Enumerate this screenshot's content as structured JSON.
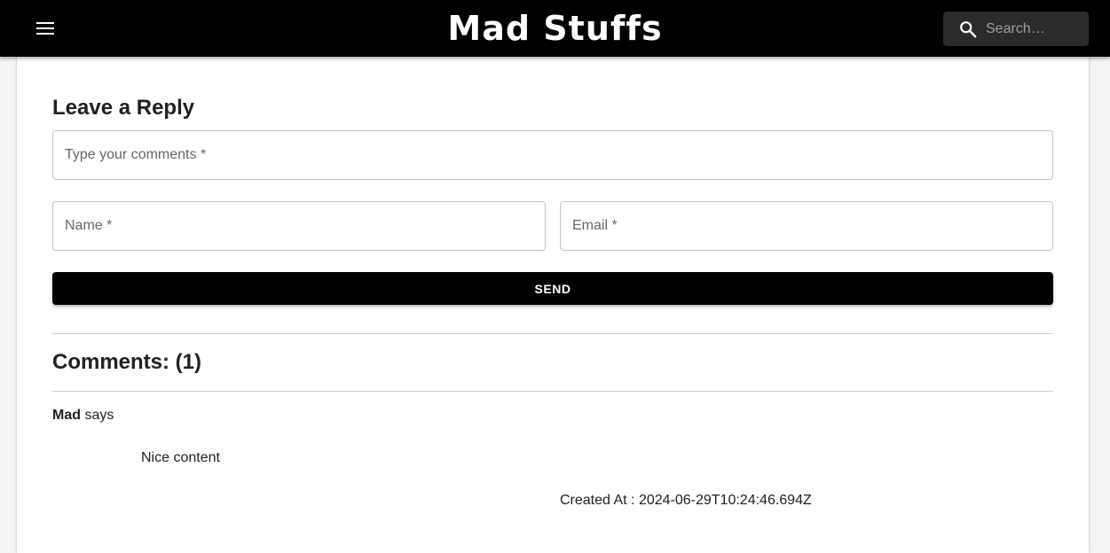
{
  "header": {
    "brand": "Mad Stuffs",
    "menu_icon": "menu-icon",
    "search_icon": "search-icon",
    "search_placeholder": "Search…"
  },
  "reply_form": {
    "title": "Leave a Reply",
    "comment_placeholder": "Type your comments *",
    "name_placeholder": "Name *",
    "email_placeholder": "Email *",
    "send_label": "SEND"
  },
  "comments": {
    "title": "Comments: (1)",
    "items": [
      {
        "author": "Mad",
        "says": "says",
        "body": "Nice content",
        "created_at": "Created At : 2024-06-29T10:24:46.694Z"
      }
    ]
  },
  "colors": {
    "appbar": "#000000",
    "button": "#000000",
    "search_bg": "#2b2b2b"
  }
}
